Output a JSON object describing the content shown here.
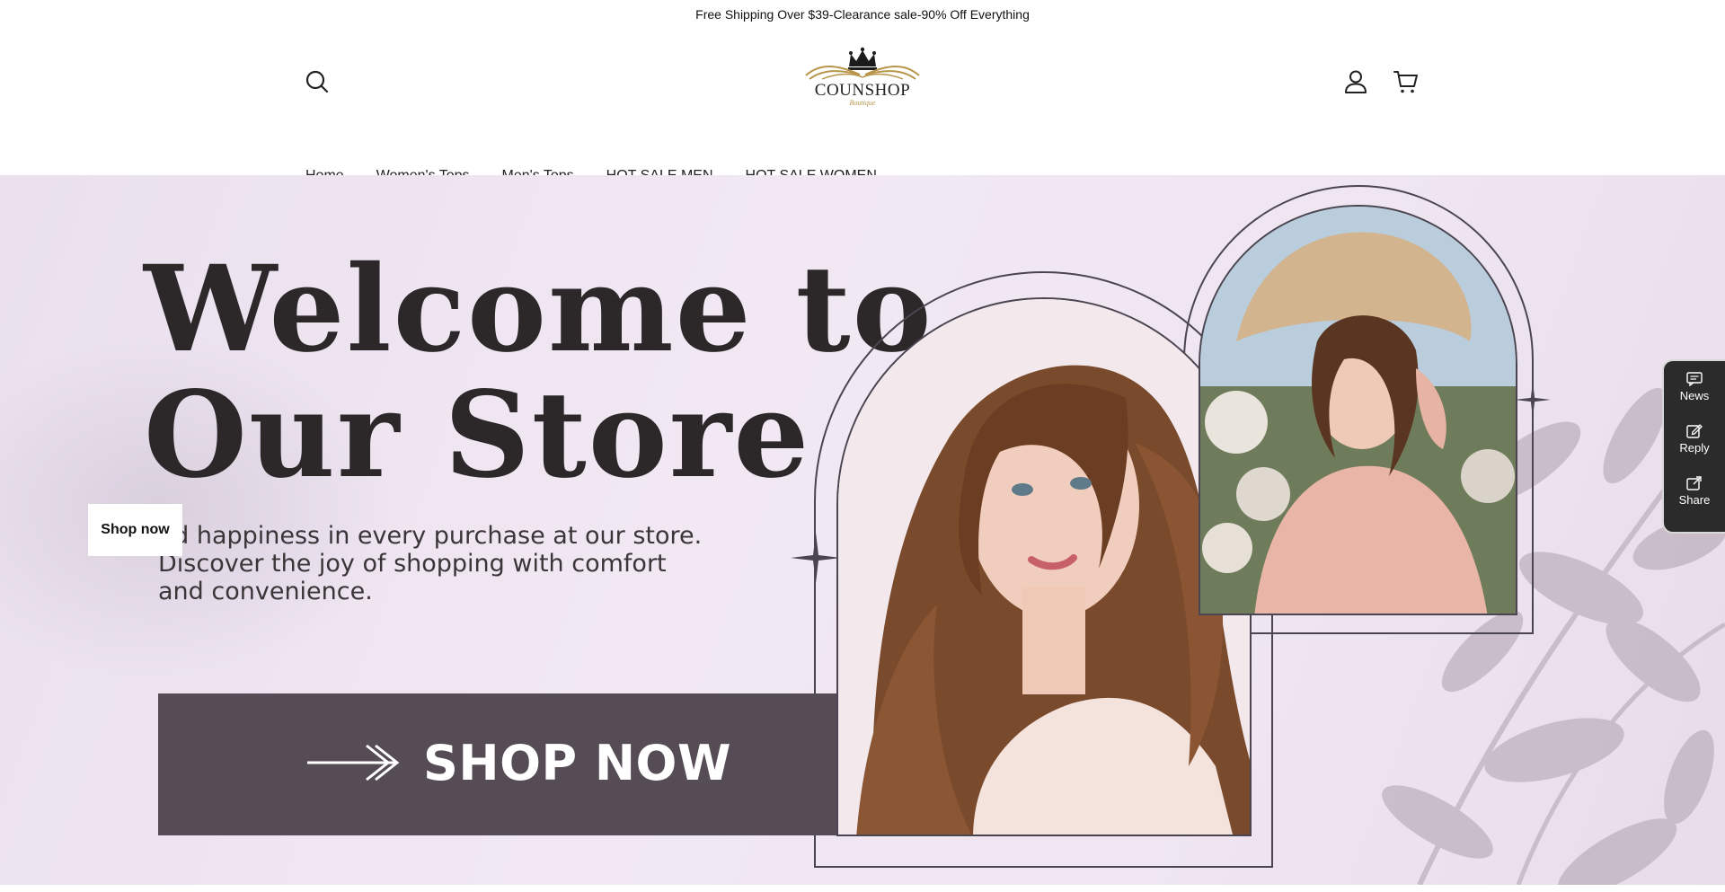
{
  "announcement": "Free Shipping Over $39-Clearance sale-90% Off Everything",
  "logo": {
    "name": "COUNSHOP",
    "subtitle": "Boutique"
  },
  "header": {
    "icons": {
      "search": "search-icon",
      "account": "user-icon",
      "cart": "cart-icon"
    }
  },
  "nav": {
    "items": [
      "Home",
      "Women's Tops",
      "Men's Tops",
      "HOT SALE MEN",
      "HOT SALE WOMEN"
    ]
  },
  "hero": {
    "title_line1": "Welcome to",
    "title_line2": "Our Store",
    "tagline_line1": "nd happiness in every purchase at our store.",
    "tagline_line2": "Discover the joy of shopping with comfort",
    "tagline_line3": "and convenience.",
    "shop_now_button": "Shop now",
    "banner_cta": "SHOP NOW"
  },
  "float_panel": {
    "items": [
      {
        "label": "News",
        "icon": "message-icon"
      },
      {
        "label": "Reply",
        "icon": "edit-icon"
      },
      {
        "label": "Share",
        "icon": "share-icon"
      }
    ]
  },
  "colors": {
    "hero_bg": "#efe6f1",
    "banner_bg": "#554c56",
    "title_text": "#2c282a",
    "logo_gold": "#b8954a",
    "panel_bg": "#2b2b2b"
  }
}
